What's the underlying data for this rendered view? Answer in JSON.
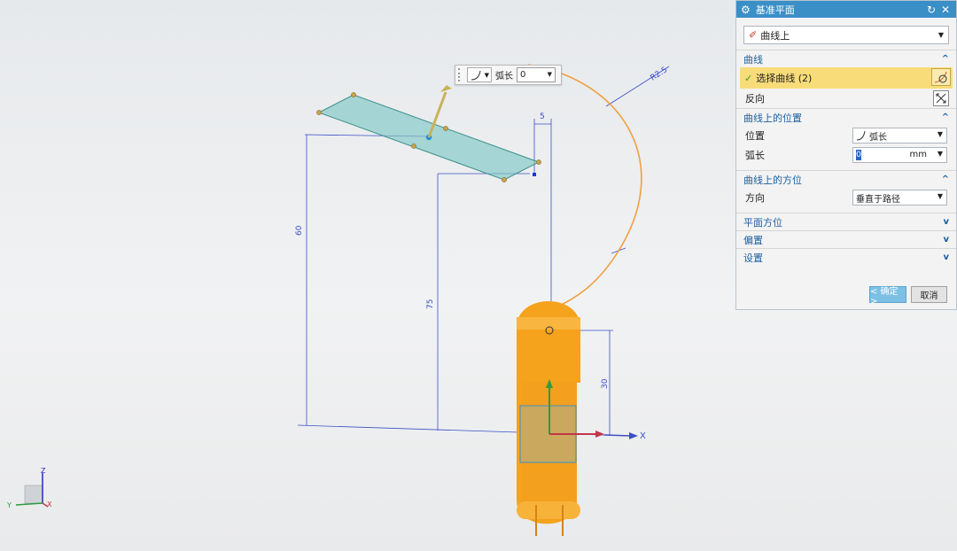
{
  "viewport": {
    "dimensions": {
      "d1": "60",
      "d2": "75",
      "d3": "5",
      "d4": "30",
      "radius": "R2.5"
    },
    "axis_x": "X",
    "triad": {
      "z": "Z",
      "y": "Y",
      "x": "X"
    }
  },
  "float_toolbar": {
    "label": "弧长",
    "value": "0"
  },
  "dialog": {
    "title": "基准平面",
    "type_value": "曲线上",
    "sections": {
      "curve": {
        "header": "曲线",
        "select_label": "选择曲线 (2)",
        "reverse_label": "反向"
      },
      "position": {
        "header": "曲线上的位置",
        "location_label": "位置",
        "location_value": "弧长",
        "arclength_label": "弧长",
        "arclength_value": "0",
        "arclength_unit": "mm"
      },
      "orientation": {
        "header": "曲线上的方位",
        "direction_label": "方向",
        "direction_value": "垂直于路径"
      },
      "plane_orientation": {
        "header": "平面方位"
      },
      "offset": {
        "header": "偏置"
      },
      "settings": {
        "header": "设置"
      }
    },
    "ok_label": "< 确定 >",
    "cancel_label": "取消"
  },
  "colors": {
    "title_bar": "#3a8fc7",
    "section_text": "#1a5f9e",
    "highlight_row": "#f9dc7a",
    "part_orange": "#f5a21c",
    "plane_fill": "#7fc7c4",
    "dimension_blue": "#3b4fc7",
    "curve_orange": "#f0a040"
  }
}
